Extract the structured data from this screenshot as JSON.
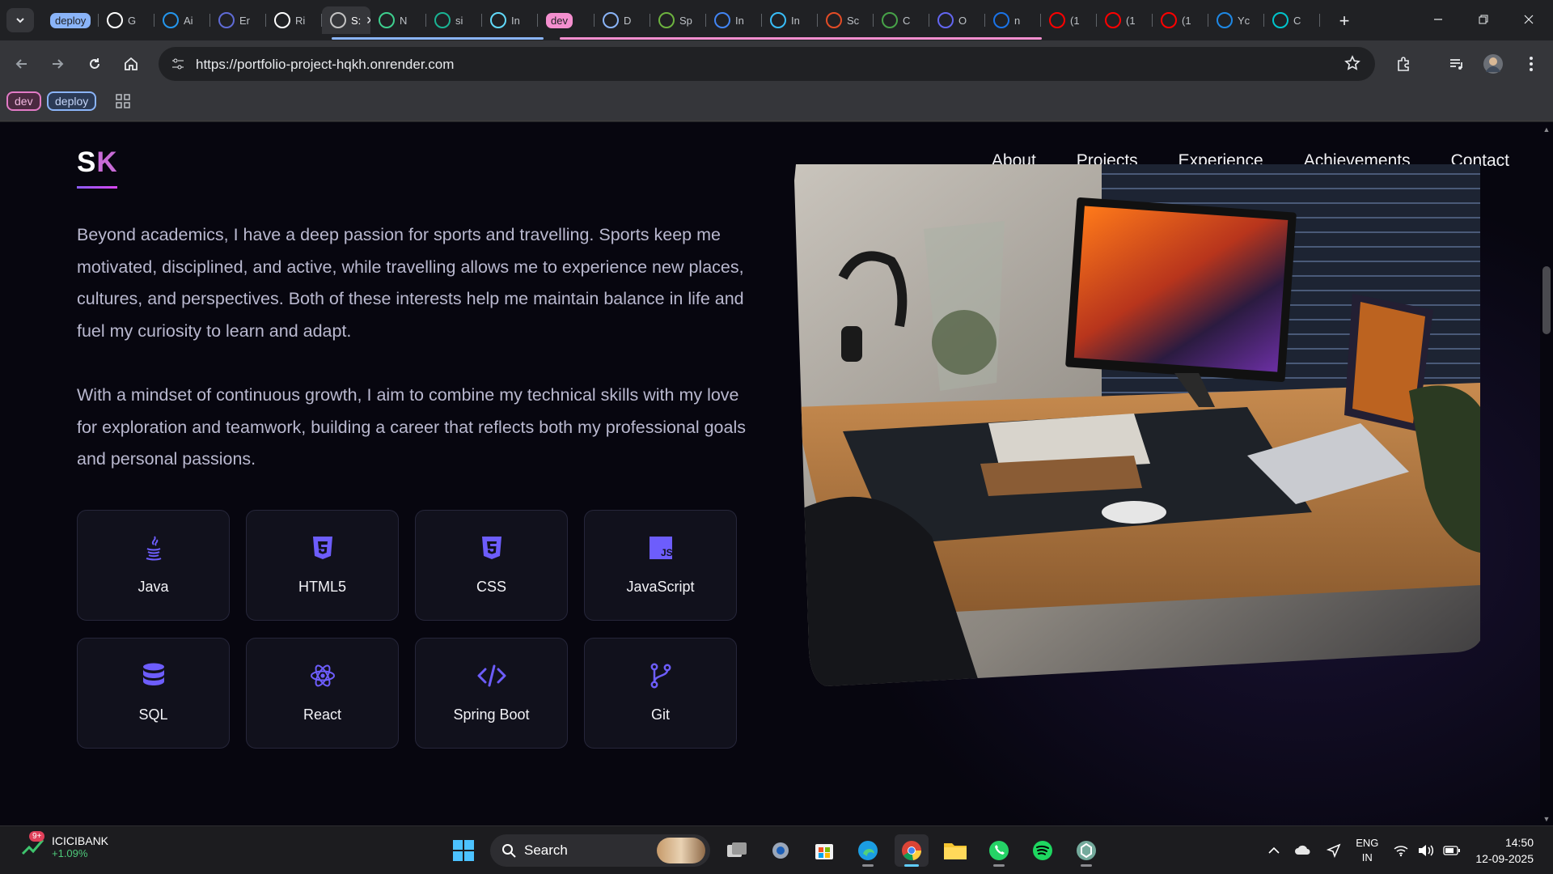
{
  "browser": {
    "tabs": [
      {
        "label": "deploy",
        "kind": "group",
        "color": "#8ab4f8"
      },
      {
        "label": "G",
        "icon": "github-icon",
        "color": "#ffffff"
      },
      {
        "label": "Ai",
        "icon": "docker-icon",
        "color": "#2496ed"
      },
      {
        "label": "Er",
        "icon": "circle-icon",
        "color": "#5f6bd6"
      },
      {
        "label": "Ri",
        "icon": "render-icon",
        "color": "#ffffff"
      },
      {
        "label": "S:",
        "icon": "site-icon",
        "color": "#c3c3c3",
        "active": true
      },
      {
        "label": "N",
        "icon": "n-icon",
        "color": "#3ecf8e"
      },
      {
        "label": "si",
        "icon": "diamond-icon",
        "color": "#1ab394"
      },
      {
        "label": "In",
        "icon": "react-icon",
        "color": "#61dafb"
      },
      {
        "label": "dev",
        "kind": "group",
        "color": "#f48fcf"
      },
      {
        "label": "D",
        "icon": "cog-icon",
        "color": "#8ab4f8"
      },
      {
        "label": "Sp",
        "icon": "spring-icon",
        "color": "#6db33f"
      },
      {
        "label": "In",
        "icon": "m-icon",
        "color": "#4285f4"
      },
      {
        "label": "In",
        "icon": "tailwind-icon",
        "color": "#38bdf8"
      },
      {
        "label": "Sc",
        "icon": "blocks-icon",
        "color": "#e34c26"
      },
      {
        "label": "C",
        "icon": "leaf-icon",
        "color": "#47a248"
      },
      {
        "label": "O",
        "icon": "c-icon",
        "color": "#6366f1"
      },
      {
        "label": "n",
        "icon": "n-square-icon",
        "color": "#1a73e8"
      },
      {
        "label": "(1",
        "icon": "youtube-icon",
        "color": "#ff0000"
      },
      {
        "label": "(1",
        "icon": "youtube-icon",
        "color": "#ff0000"
      },
      {
        "label": "(1",
        "icon": "youtube-icon",
        "color": "#ff0000"
      },
      {
        "label": "Yc",
        "icon": "s-square-icon",
        "color": "#1e88e5"
      },
      {
        "label": "C",
        "icon": "canva-icon",
        "color": "#00c4cc"
      }
    ],
    "url": "https://portfolio-project-hqkh.onrender.com",
    "bookmarks": {
      "dev": "dev",
      "deploy": "deploy"
    }
  },
  "page": {
    "logo": {
      "first": "S",
      "second": "K"
    },
    "nav": [
      "About",
      "Projects",
      "Experience",
      "Achievements",
      "Contact"
    ],
    "paragraphs": [
      "Beyond academics, I have a deep passion for sports and travelling. Sports keep me motivated, disciplined, and active, while travelling allows me to experience new places, cultures, and perspectives. Both of these interests help me maintain balance in life and fuel my curiosity to learn and adapt.",
      "With a mindset of continuous growth, I aim to combine my technical skills with my love for exploration and teamwork, building a career that reflects both my professional goals and personal passions."
    ],
    "skills": [
      {
        "name": "Java",
        "icon": "java-icon"
      },
      {
        "name": "HTML5",
        "icon": "html5-icon"
      },
      {
        "name": "CSS",
        "icon": "css3-icon"
      },
      {
        "name": "JavaScript",
        "icon": "js-icon"
      },
      {
        "name": "SQL",
        "icon": "database-icon"
      },
      {
        "name": "React",
        "icon": "react-icon"
      },
      {
        "name": "Spring Boot",
        "icon": "code-icon"
      },
      {
        "name": "Git",
        "icon": "git-branch-icon"
      }
    ],
    "accent": "#6d5dfc"
  },
  "taskbar": {
    "stock": {
      "name": "ICICIBANK",
      "change": "+1.09%",
      "badge": "9+"
    },
    "search": "Search",
    "lang": {
      "line1": "ENG",
      "line2": "IN"
    },
    "time": "14:50",
    "date": "12-09-2025"
  }
}
